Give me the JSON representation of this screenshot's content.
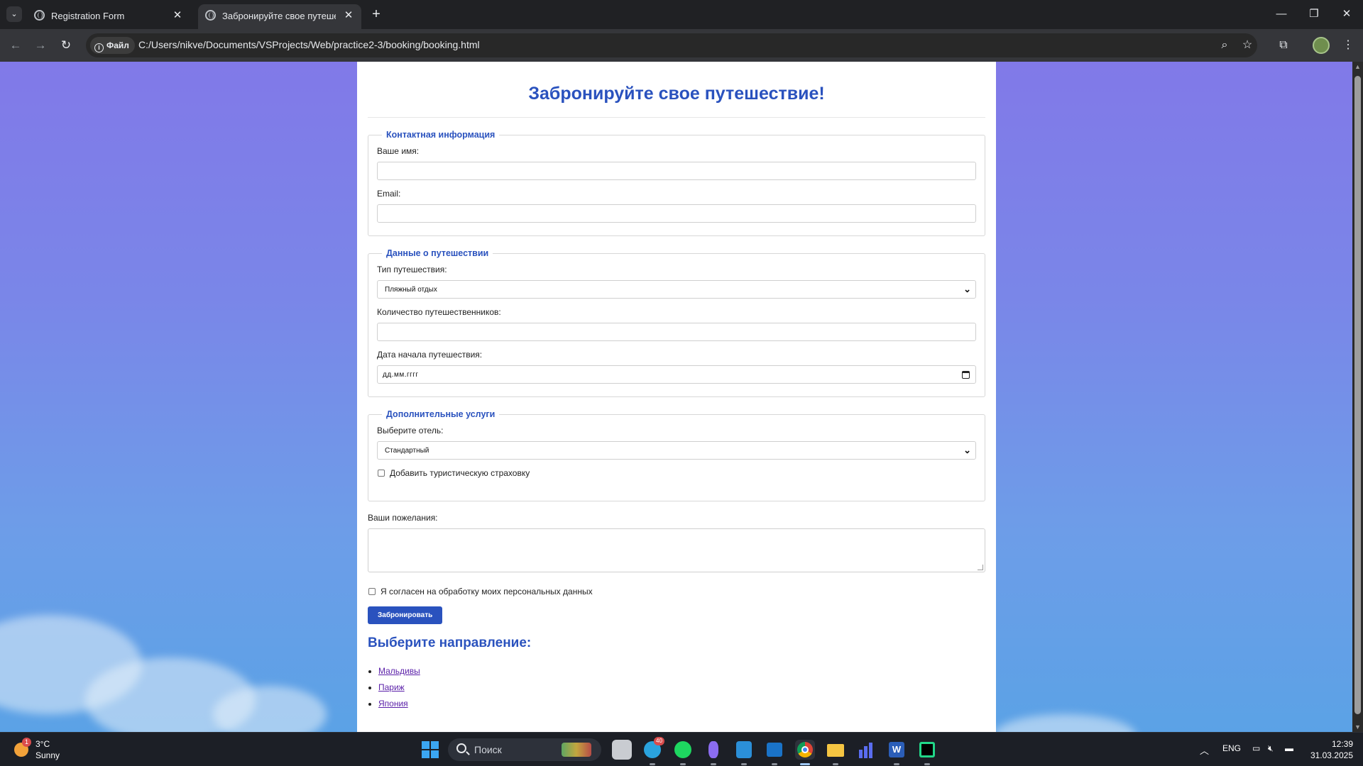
{
  "browser": {
    "tabs": [
      {
        "title": "Registration Form",
        "active": false
      },
      {
        "title": "Забронируйте свое путешествие!",
        "active": true
      }
    ],
    "site_chip": "Файл",
    "url": "C:/Users/nikve/Documents/VSProjects/Web/practice2-3/booking/booking.html"
  },
  "page": {
    "title": "Забронируйте свое путешествие!",
    "contact": {
      "legend": "Контактная информация",
      "name_label": "Ваше имя:",
      "email_label": "Email:"
    },
    "travel": {
      "legend": "Данные о путешествии",
      "type_label": "Тип путешествия:",
      "type_value": "Пляжный отдых",
      "travelers_label": "Количество путешественников:",
      "date_label": "Дата начала путешествия:",
      "date_placeholder": "дд.мм.гггг"
    },
    "extras": {
      "legend": "Дополнительные услуги",
      "hotel_label": "Выберите отель:",
      "hotel_value": "Стандартный",
      "insurance_label": "Добавить туристическую страховку"
    },
    "wishes_label": "Ваши пожелания:",
    "consent_label": "Я согласен на обработку моих персональных данных",
    "submit_label": "Забронировать",
    "destinations_title": "Выберите направление:",
    "destinations": [
      "Мальдивы",
      "Париж",
      "Япония"
    ]
  },
  "taskbar": {
    "weather_temp": "3°C",
    "weather_condition": "Sunny",
    "weather_badge": "1",
    "search_placeholder": "Поиск",
    "telegram_badge": "40",
    "language": "ENG",
    "time": "12:39",
    "date": "31.03.2025"
  },
  "colors": {
    "accent": "#2a52be",
    "link": "#5a1fa8"
  }
}
